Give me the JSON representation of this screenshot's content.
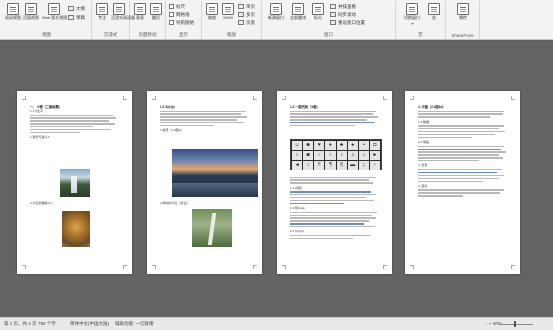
{
  "ribbon": {
    "groups": [
      {
        "label": "视图",
        "buttons": [
          "阅读视图",
          "页面视图",
          "Web 版式视图"
        ],
        "small": [
          "大纲",
          "草稿"
        ]
      },
      {
        "label": "沉浸式",
        "buttons": [
          "专注",
          "沉浸式阅读器"
        ]
      },
      {
        "label": "页面移动",
        "buttons": [
          "垂直",
          "翻页"
        ]
      },
      {
        "label": "显示",
        "checks": [
          "标尺",
          "网格线",
          "导航窗格"
        ]
      },
      {
        "label": "缩放",
        "buttons": [
          "缩放",
          "100%"
        ],
        "small": [
          "单页",
          "多页",
          "页宽"
        ]
      },
      {
        "label": "窗口",
        "buttons": [
          "新建窗口",
          "全部重排",
          "拆分"
        ],
        "small": [
          "并排查看",
          "同步滚动",
          "重设窗口位置"
        ]
      },
      {
        "label": "宏",
        "buttons": [
          "切换窗口",
          "宏"
        ]
      },
      {
        "label": "SharePoint",
        "buttons": [
          "属性"
        ]
      }
    ]
  },
  "pages": {
    "p1": {
      "heading": "一、人物（二级标题）",
      "sub": "1.1 X生平",
      "caption1": "1.我曾与游人X",
      "caption2": "2.大红熊猫等人1"
    },
    "p2": {
      "heading": "1.2 X(x1)x",
      "caption1": "1.晚景（7.9图A）",
      "caption2": "2.雨中的大红（标注）"
    },
    "p3": {
      "heading": "1.3 一般代码（X级）",
      "symbols": [
        "☺",
        "☻",
        "♥",
        "♦",
        "♣",
        "♠",
        "•",
        "◘",
        "○",
        "◙",
        "♂",
        "♀",
        "♪",
        "♫",
        "☼",
        "►",
        "◄",
        "↕",
        "‼",
        "¶",
        "§",
        "▬",
        "↨",
        "↑"
      ],
      "caption1": "1.4 内容）",
      "caption2": "2.1 阿(x)ab",
      "caption3": "1.5 X(x)(1)"
    },
    "p4": {
      "heading": "4. 中国（2.1图1a）",
      "sub": "1.2 数据：",
      "caption1": "2.2 前提",
      "caption2": "3. 位置",
      "caption3": "4. 结论"
    }
  },
  "statusbar": {
    "page": "第 1 页，共 4 页",
    "words": "798 个字",
    "lang": "简体中文(中国大陆)",
    "accessibility": "辅助功能: 一切就绪",
    "zoom": "- + 40%"
  }
}
